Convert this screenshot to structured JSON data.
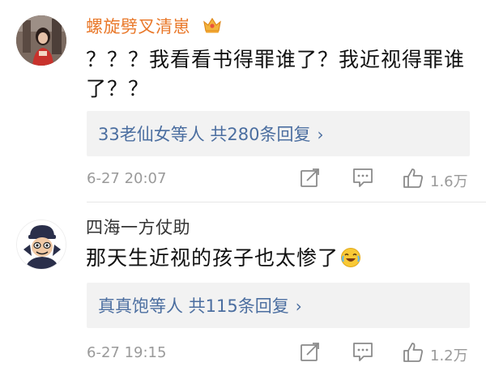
{
  "comments": [
    {
      "username": "螺旋劈叉清崽",
      "badge_icon": "crown-icon",
      "text": "？？？我看看书得罪谁了？我近视得罪谁了？？",
      "reply_users": "33老仙女",
      "reply_others_label": "等人 共280条回复",
      "chevron": "›",
      "time": "6-27 20:07",
      "likes": "1.6万"
    },
    {
      "username": "四海一方仗助",
      "text": "那天生近视的孩子也太惨了",
      "emoji_icon": "laugh-cry-emoji-icon",
      "reply_users": "真真饱",
      "reply_others_label": "等人 共115条回复",
      "chevron": "›",
      "time": "6-27 19:15",
      "likes": "1.2万"
    }
  ],
  "colors": {
    "vip_name": "#e9792b",
    "link": "#4b6ea0",
    "meta": "#9a9a9a",
    "reply_bg": "#f2f2f2"
  }
}
